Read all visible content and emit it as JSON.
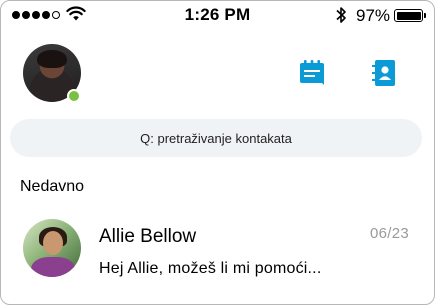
{
  "status_bar": {
    "signal_dots_filled": 4,
    "signal_dots_total": 5,
    "time": "1:26 PM",
    "battery_percent": "97%"
  },
  "header": {
    "presence_status": "available",
    "new_chat_icon": "new-chat-icon",
    "contacts_icon": "contacts-book-icon"
  },
  "search": {
    "placeholder": "Q: pretraživanje kontakata"
  },
  "recent": {
    "section_label": "Nedavno",
    "conversations": [
      {
        "name": "Allie Bellow",
        "date": "06/23",
        "preview": "Hej Allie, možeš li mi pomoći..."
      }
    ]
  },
  "colors": {
    "accent": "#0a9bd7",
    "presence_available": "#7ac142",
    "search_bg": "#f0f3f5",
    "date_text": "#9a9a9a"
  }
}
